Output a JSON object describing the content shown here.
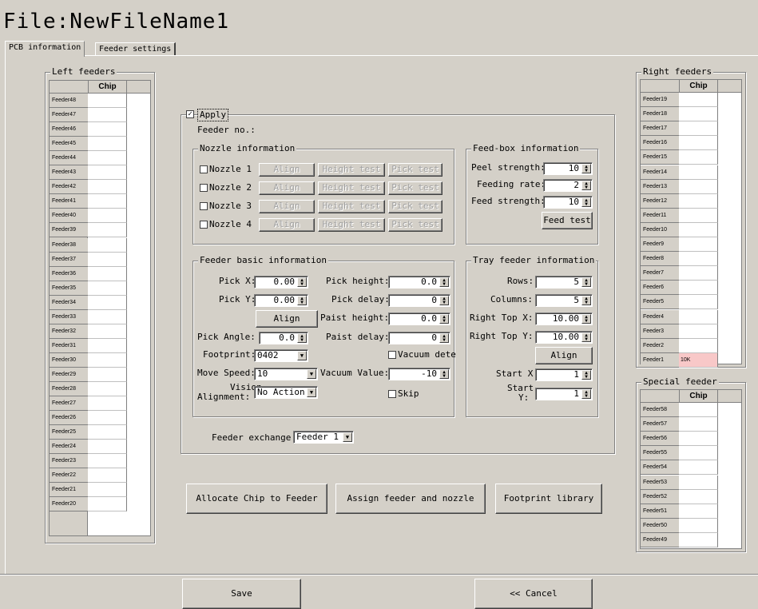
{
  "window": {
    "title": "File:NewFileName1"
  },
  "tabs": [
    {
      "label": "PCB information"
    },
    {
      "label": "Feeder settings"
    }
  ],
  "left_feeders": {
    "title": "Left feeders",
    "column": "Chip Spec.",
    "rows": [
      {
        "name": "Feeder48",
        "spec": ""
      },
      {
        "name": "Feeder47",
        "spec": ""
      },
      {
        "name": "Feeder46",
        "spec": ""
      },
      {
        "name": "Feeder45",
        "spec": ""
      },
      {
        "name": "Feeder44",
        "spec": ""
      },
      {
        "name": "Feeder43",
        "spec": ""
      },
      {
        "name": "Feeder42",
        "spec": ""
      },
      {
        "name": "Feeder41",
        "spec": ""
      },
      {
        "name": "Feeder40",
        "spec": ""
      },
      {
        "name": "Feeder39",
        "spec": ""
      },
      {
        "name": "Feeder38",
        "spec": ""
      },
      {
        "name": "Feeder37",
        "spec": ""
      },
      {
        "name": "Feeder36",
        "spec": ""
      },
      {
        "name": "Feeder35",
        "spec": ""
      },
      {
        "name": "Feeder34",
        "spec": ""
      },
      {
        "name": "Feeder33",
        "spec": ""
      },
      {
        "name": "Feeder32",
        "spec": ""
      },
      {
        "name": "Feeder31",
        "spec": ""
      },
      {
        "name": "Feeder30",
        "spec": ""
      },
      {
        "name": "Feeder29",
        "spec": ""
      },
      {
        "name": "Feeder28",
        "spec": ""
      },
      {
        "name": "Feeder27",
        "spec": ""
      },
      {
        "name": "Feeder26",
        "spec": ""
      },
      {
        "name": "Feeder25",
        "spec": ""
      },
      {
        "name": "Feeder24",
        "spec": ""
      },
      {
        "name": "Feeder23",
        "spec": ""
      },
      {
        "name": "Feeder22",
        "spec": ""
      },
      {
        "name": "Feeder21",
        "spec": ""
      },
      {
        "name": "Feeder20",
        "spec": ""
      }
    ]
  },
  "right_feeders": {
    "title": "Right feeders",
    "column": "Chip Spec.",
    "rows": [
      {
        "name": "Feeder19",
        "spec": ""
      },
      {
        "name": "Feeder18",
        "spec": ""
      },
      {
        "name": "Feeder17",
        "spec": ""
      },
      {
        "name": "Feeder16",
        "spec": ""
      },
      {
        "name": "Feeder15",
        "spec": ""
      },
      {
        "name": "Feeder14",
        "spec": ""
      },
      {
        "name": "Feeder13",
        "spec": ""
      },
      {
        "name": "Feeder12",
        "spec": ""
      },
      {
        "name": "Feeder11",
        "spec": ""
      },
      {
        "name": "Feeder10",
        "spec": ""
      },
      {
        "name": "Feeder9",
        "spec": ""
      },
      {
        "name": "Feeder8",
        "spec": ""
      },
      {
        "name": "Feeder7",
        "spec": ""
      },
      {
        "name": "Feeder6",
        "spec": ""
      },
      {
        "name": "Feeder5",
        "spec": ""
      },
      {
        "name": "Feeder4",
        "spec": ""
      },
      {
        "name": "Feeder3",
        "spec": ""
      },
      {
        "name": "Feeder2",
        "spec": ""
      },
      {
        "name": "Feeder1",
        "spec": "10K"
      }
    ]
  },
  "special_feeder": {
    "title": "Special feeder",
    "column": "Chip Spec.",
    "rows": [
      {
        "name": "Feeder58",
        "spec": ""
      },
      {
        "name": "Feeder57",
        "spec": ""
      },
      {
        "name": "Feeder56",
        "spec": ""
      },
      {
        "name": "Feeder55",
        "spec": ""
      },
      {
        "name": "Feeder54",
        "spec": ""
      },
      {
        "name": "Feeder53",
        "spec": ""
      },
      {
        "name": "Feeder52",
        "spec": ""
      },
      {
        "name": "Feeder51",
        "spec": ""
      },
      {
        "name": "Feeder50",
        "spec": ""
      },
      {
        "name": "Feeder49",
        "spec": ""
      }
    ]
  },
  "apply": {
    "label": "Apply",
    "checked": true
  },
  "feeder_no_label": "Feeder no.:",
  "nozzle_info": {
    "title": "Nozzle information",
    "nozzles": [
      {
        "label": "Nozzle 1"
      },
      {
        "label": "Nozzle 2"
      },
      {
        "label": "Nozzle 3"
      },
      {
        "label": "Nozzle 4"
      }
    ],
    "align_label": "Align",
    "height_test_label": "Height test",
    "pick_test_label": "Pick test"
  },
  "feed_box": {
    "title": "Feed-box information",
    "peel_strength_label": "Peel strength:",
    "peel_strength": "10",
    "feeding_rate_label": "Feeding rate:",
    "feeding_rate": "2",
    "feed_strength_label": "Feed strength:",
    "feed_strength": "10",
    "feed_test_label": "Feed test"
  },
  "basic": {
    "title": "Feeder basic information",
    "pick_x_label": "Pick X:",
    "pick_x": "0.00",
    "pick_y_label": "Pick Y:",
    "pick_y": "0.00",
    "align_label": "Align",
    "pick_angle_label": "Pick Angle:",
    "pick_angle": "0.0",
    "footprint_label": "Footprint:",
    "footprint": "0402",
    "move_speed_label": "Move Speed:",
    "move_speed": "10",
    "vision_label_1": "Vision",
    "vision_label_2": "Alignment:",
    "vision": "No Action",
    "pick_height_label": "Pick height:",
    "pick_height": "0.0",
    "pick_delay_label": "Pick delay:",
    "pick_delay": "0",
    "paist_height_label": "Paist height:",
    "paist_height": "0.0",
    "paist_delay_label": "Paist delay:",
    "paist_delay": "0",
    "vacuum_dete_label": "Vacuum dete",
    "vacuum_value_label": "Vacuum Value:",
    "vacuum_value": "-10",
    "skip_label": "Skip"
  },
  "tray": {
    "title": "Tray feeder information",
    "rows_label": "Rows:",
    "rows": "5",
    "columns_label": "Columns:",
    "columns": "5",
    "rtx_label": "Right Top X:",
    "rtx": "10.00",
    "rty_label": "Right Top Y:",
    "rty": "10.00",
    "align_label": "Align",
    "start_x_label": "Start X:",
    "start_x": "1",
    "start_y_label_1": "Start",
    "start_y_label_2": "Y:",
    "start_y": "1"
  },
  "exchange": {
    "label": "Feeder exchange:",
    "value": "Feeder 1"
  },
  "actions": {
    "allocate": "Allocate Chip to Feeder",
    "assign": "Assign feeder and nozzle",
    "footprint_lib": "Footprint library"
  },
  "footer": {
    "save": "Save",
    "cancel": "<< Cancel"
  }
}
